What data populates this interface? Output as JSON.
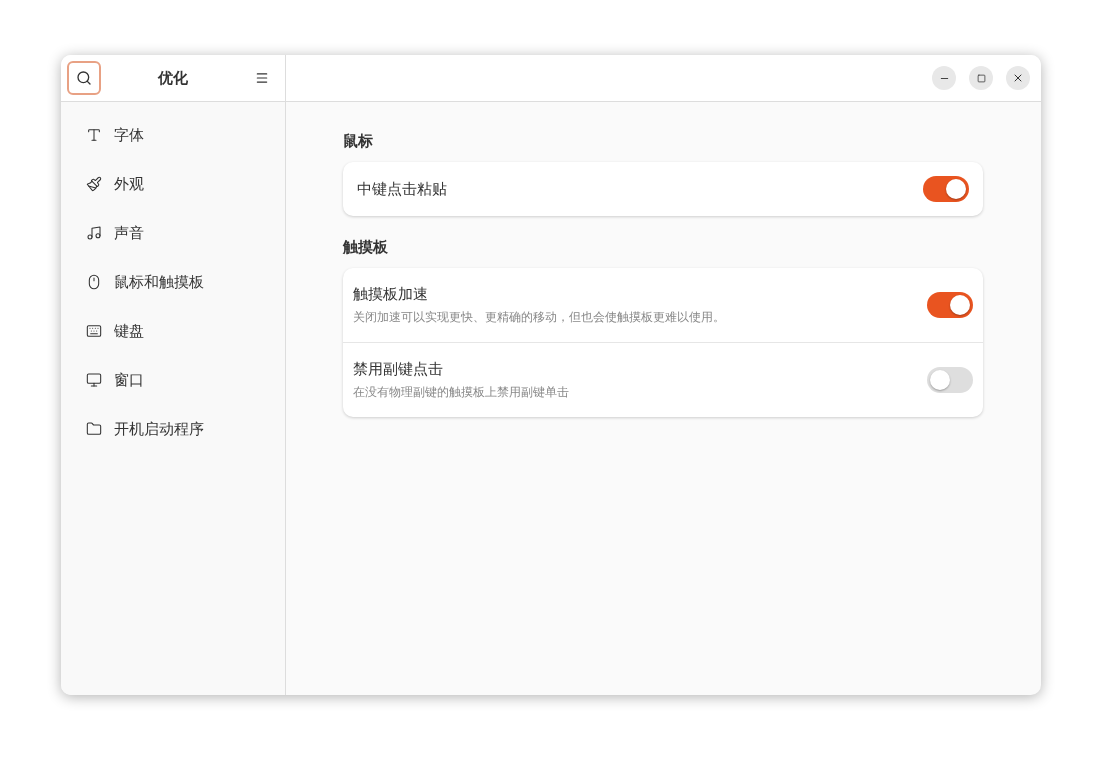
{
  "sidebar": {
    "title": "优化",
    "items": [
      {
        "label": "字体",
        "selected": false
      },
      {
        "label": "外观",
        "selected": false
      },
      {
        "label": "声音",
        "selected": false
      },
      {
        "label": "鼠标和触摸板",
        "selected": false
      },
      {
        "label": "键盘",
        "selected": false
      },
      {
        "label": "窗口",
        "selected": false
      },
      {
        "label": "开机启动程序",
        "selected": false
      }
    ]
  },
  "sections": [
    {
      "title": "鼠标",
      "rows": [
        {
          "label": "中键点击粘贴",
          "on": true
        }
      ]
    },
    {
      "title": "触摸板",
      "rows": [
        {
          "label": "触摸板加速",
          "description": "关闭加速可以实现更快、更精确的移动，但也会使触摸板更难以使用。",
          "on": true
        },
        {
          "label": "禁用副键点击",
          "description": "在没有物理副键的触摸板上禁用副键单击",
          "on": false
        }
      ]
    }
  ]
}
